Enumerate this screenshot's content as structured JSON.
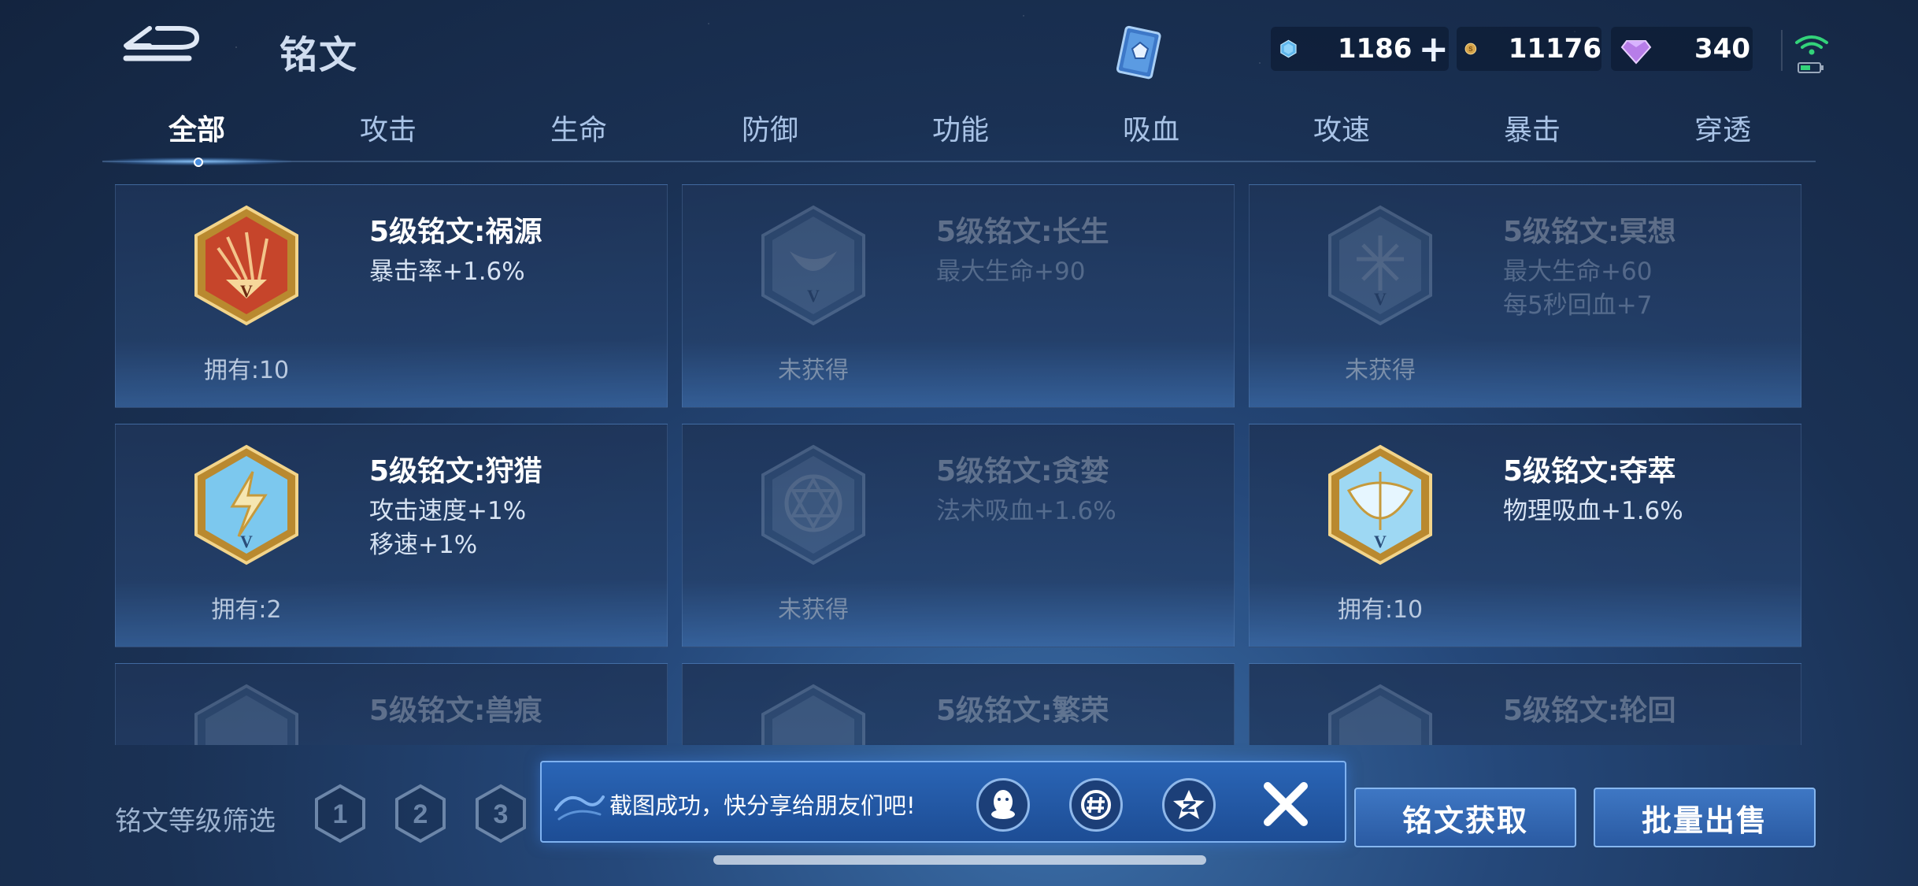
{
  "header": {
    "title": "铭文",
    "currencies": [
      {
        "name": "diamond",
        "value": "1186"
      },
      {
        "name": "gold",
        "value": "11176"
      },
      {
        "name": "gem",
        "value": "340"
      }
    ]
  },
  "tabs": [
    "全部",
    "攻击",
    "生命",
    "防御",
    "功能",
    "吸血",
    "攻速",
    "暴击",
    "穿透"
  ],
  "active_tab": "全部",
  "cards": [
    {
      "name": "5级铭文:祸源",
      "stats": [
        "暴击率+1.6%"
      ],
      "count": "拥有:10",
      "owned": true,
      "icon": "huoyuan-icon",
      "color": "red"
    },
    {
      "name": "5级铭文:长生",
      "stats": [
        "最大生命+90"
      ],
      "count": "未获得",
      "owned": false,
      "icon": "changsheng-icon",
      "color": "gray"
    },
    {
      "name": "5级铭文:冥想",
      "stats": [
        "最大生命+60",
        "每5秒回血+7"
      ],
      "count": "未获得",
      "owned": false,
      "icon": "mingxiang-icon",
      "color": "gray"
    },
    {
      "name": "5级铭文:狩猎",
      "stats": [
        "攻击速度+1%",
        "移速+1%"
      ],
      "count": "拥有:2",
      "owned": true,
      "icon": "shoulie-icon",
      "color": "blue"
    },
    {
      "name": "5级铭文:贪婪",
      "stats": [
        "法术吸血+1.6%"
      ],
      "count": "未获得",
      "owned": false,
      "icon": "tanlan-icon",
      "color": "gray"
    },
    {
      "name": "5级铭文:夺萃",
      "stats": [
        "物理吸血+1.6%"
      ],
      "count": "拥有:10",
      "owned": true,
      "icon": "duocui-icon",
      "color": "blue"
    },
    {
      "name": "5级铭文:兽痕",
      "stats": [],
      "count": "",
      "owned": false,
      "icon": "shouhen-icon",
      "color": "gray"
    },
    {
      "name": "5级铭文:繁荣",
      "stats": [],
      "count": "",
      "owned": false,
      "icon": "fanrong-icon",
      "color": "gray"
    },
    {
      "name": "5级铭文:轮回",
      "stats": [],
      "count": "",
      "owned": false,
      "icon": "lunhui-icon",
      "color": "gray"
    }
  ],
  "filter": {
    "label": "铭文等级筛选",
    "levels": [
      "1",
      "2",
      "3"
    ]
  },
  "toast": {
    "text": "截图成功，快分享给朋友们吧!",
    "share_targets": [
      "qq-icon",
      "wechat-moments-icon",
      "qzone-icon"
    ]
  },
  "actions": {
    "obtain": "铭文获取",
    "sell": "批量出售"
  },
  "colors": {
    "accent": "#2a65b6",
    "tab_active": "#ffffff",
    "tab_inactive": "#a9c3e6"
  }
}
